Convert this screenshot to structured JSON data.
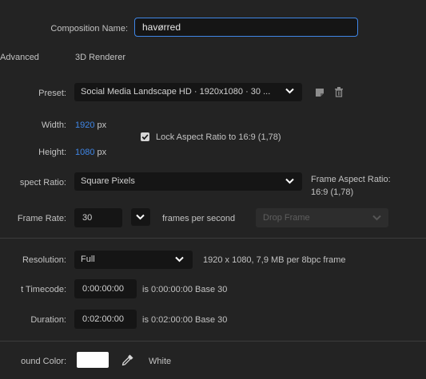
{
  "composition": {
    "name_label": "Composition Name:",
    "name_value": "havørred"
  },
  "tabs": [
    "Advanced",
    "3D Renderer"
  ],
  "preset": {
    "label": "Preset:",
    "value": "Social Media Landscape HD · 1920x1080 · 30 ..."
  },
  "size": {
    "width_label": "Width:",
    "width_value": "1920",
    "height_label": "Height:",
    "height_value": "1080",
    "unit": "px",
    "lock_label": "Lock Aspect Ratio to 16:9 (1,78)",
    "lock_checked": true
  },
  "aspect": {
    "label": "spect Ratio:",
    "value": "Square Pixels",
    "frame_label": "Frame Aspect Ratio:",
    "frame_value": "16:9 (1,78)"
  },
  "frame_rate": {
    "label": "Frame Rate:",
    "value": "30",
    "unit": "frames per second",
    "drop_frame": "Drop Frame"
  },
  "resolution": {
    "label": "Resolution:",
    "value": "Full",
    "info": "1920 x 1080, 7,9 MB per 8bpc frame"
  },
  "start_timecode": {
    "label": "t Timecode:",
    "value": "0:00:00:00",
    "info": "is 0:00:00:00  Base 30"
  },
  "duration": {
    "label": "Duration:",
    "value": "0:02:00:00",
    "info": "is 0:02:00:00  Base 30"
  },
  "background": {
    "label": "ound Color:",
    "color": "#ffffff",
    "name": "White"
  },
  "colors": {
    "accent": "#3f86e6",
    "background": "#232323",
    "field": "#151515"
  }
}
